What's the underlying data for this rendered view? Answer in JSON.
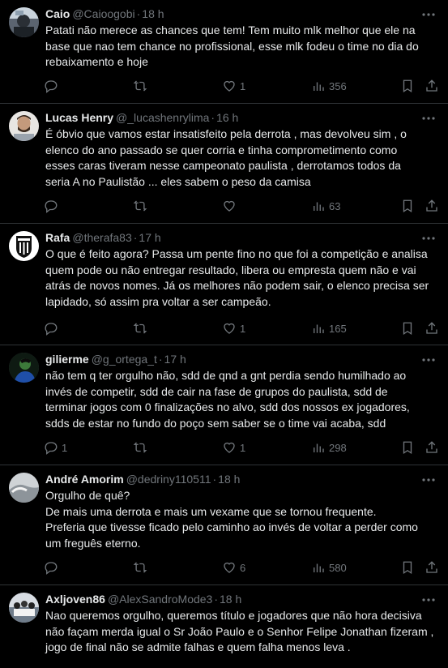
{
  "colors": {
    "background": "#000000",
    "text": "#e7e9ea",
    "muted": "#71767b",
    "divider": "#2f3336"
  },
  "tweets": [
    {
      "name": "Caio",
      "handle": "@Caioogobi",
      "dot": "·",
      "time": "18 h",
      "text": "Patati não merece as chances que tem! Tem muito mlk melhor que ele na\nbase que nao tem chance no profissional, esse mlk fodeu o time no dia do\nrebaixamento e hoje",
      "reply_count": "",
      "retweet_count": "",
      "like_count": "1",
      "view_count": "356",
      "avatar_icon": "avatar-caio"
    },
    {
      "name": "Lucas Henry",
      "handle": "@_lucashenrylima",
      "dot": "·",
      "time": "16 h",
      "text": "É óbvio que vamos estar insatisfeito pela derrota , mas devolveu sim , o\nelenco do ano passado se quer corria e tinha comprometimento como\nesses caras tiveram nesse campeonato paulista , derrotamos todos da\nseria A no Paulistão ... eles sabem o peso da camisa",
      "reply_count": "",
      "retweet_count": "",
      "like_count": "",
      "view_count": "63",
      "avatar_icon": "avatar-lucas"
    },
    {
      "name": "Rafa",
      "handle": "@therafa83",
      "dot": "·",
      "time": "17 h",
      "text": "O que é feito agora? Passa um pente fino no que foi a competição e analisa\nquem pode ou não entregar resultado, libera ou empresta quem não e vai\natrás de novos nomes. Já os melhores não podem sair, o elenco precisa ser\nlapidado, só assim pra voltar a ser campeão.",
      "reply_count": "",
      "retweet_count": "",
      "like_count": "1",
      "view_count": "165",
      "avatar_icon": "avatar-santos-crest"
    },
    {
      "name": "gilierme",
      "handle": "@g_ortega_t",
      "dot": "·",
      "time": "17 h",
      "text": "não tem q ter orgulho não, sdd de qnd a gnt perdia sendo humilhado ao\ninvés de competir, sdd de cair na fase de grupos do paulista, sdd de\nterminar jogos com 0 finalizações no alvo, sdd dos nossos ex jogadores,\nsdds de estar no fundo do poço sem saber se o time vai acaba, sdd",
      "reply_count": "1",
      "retweet_count": "",
      "like_count": "1",
      "view_count": "298",
      "avatar_icon": "avatar-gilierme"
    },
    {
      "name": "André Amorim",
      "handle": "@dedriny110511",
      "dot": "·",
      "time": "18 h",
      "text": "Orgulho de quê?\nDe mais uma derrota e mais um vexame que se tornou frequente.\nPreferia que tivesse ficado pelo caminho ao invés de voltar a perder como\num freguês eterno.",
      "reply_count": "",
      "retweet_count": "",
      "like_count": "6",
      "view_count": "580",
      "avatar_icon": "avatar-andre"
    },
    {
      "name": "Axljoven86",
      "handle": "@AlexSandroMode3",
      "dot": "·",
      "time": "18 h",
      "text": "Nao queremos orgulho, queremos título e jogadores que não hora decisiva\nnão façam merda igual o Sr João Paulo e o Senhor Felipe Jonathan fizeram ,\njogo de final não se admite falhas e quem falha menos leva .",
      "reply_count": "",
      "retweet_count": "",
      "like_count": "",
      "view_count": "",
      "avatar_icon": "avatar-axljoven"
    }
  ]
}
